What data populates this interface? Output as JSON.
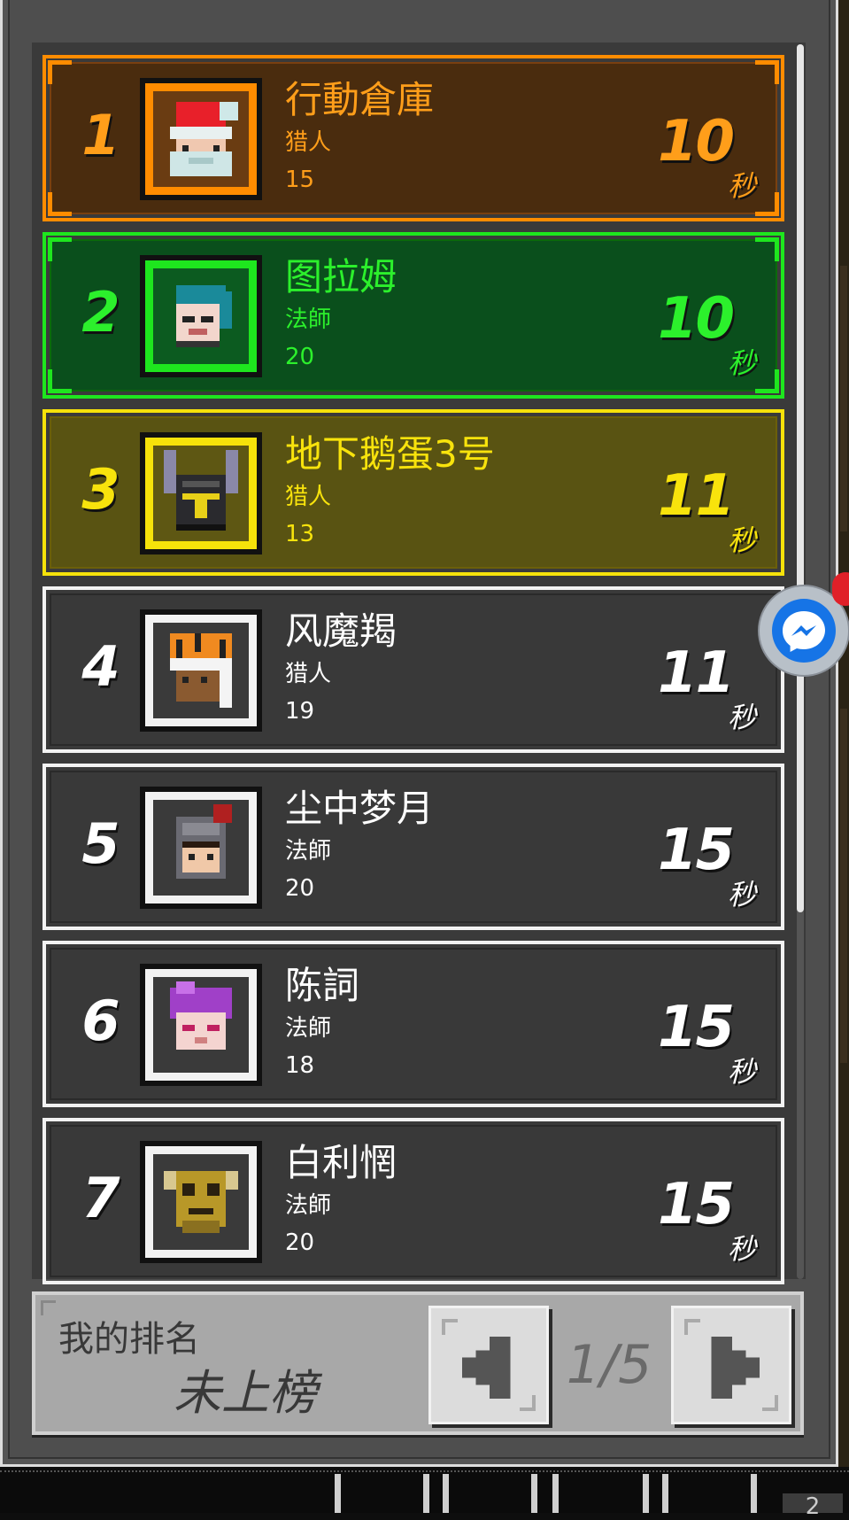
{
  "leaderboard": {
    "entries": [
      {
        "rank": "1",
        "name": "行動倉庫",
        "class": "猎人",
        "level": "15",
        "time": "10",
        "unit": "秒",
        "style": "gold",
        "avatar": "santa-hat-avatar-icon"
      },
      {
        "rank": "2",
        "name": "图拉姆",
        "class": "法師",
        "level": "20",
        "time": "10",
        "unit": "秒",
        "style": "green",
        "avatar": "teal-hair-avatar-icon"
      },
      {
        "rank": "3",
        "name": "地下鹅蛋3号",
        "class": "猎人",
        "level": "13",
        "time": "11",
        "unit": "秒",
        "style": "yellow",
        "avatar": "horned-helmet-avatar-icon"
      },
      {
        "rank": "4",
        "name": "风魔羯",
        "class": "猎人",
        "level": "19",
        "time": "11",
        "unit": "秒",
        "style": "white",
        "avatar": "tiger-hood-avatar-icon"
      },
      {
        "rank": "5",
        "name": "尘中梦月",
        "class": "法師",
        "level": "20",
        "time": "15",
        "unit": "秒",
        "style": "white",
        "avatar": "knight-helmet-avatar-icon"
      },
      {
        "rank": "6",
        "name": "陈詞",
        "class": "法師",
        "level": "18",
        "time": "15",
        "unit": "秒",
        "style": "white",
        "avatar": "purple-hair-avatar-icon"
      },
      {
        "rank": "7",
        "name": "白利惘",
        "class": "法師",
        "level": "20",
        "time": "15",
        "unit": "秒",
        "style": "white",
        "avatar": "golden-skull-avatar-icon"
      }
    ]
  },
  "footer": {
    "my_rank_label": "我的排名",
    "my_rank_value": "未上榜",
    "page_indicator": "1/5",
    "prev_icon": "left-arrow-icon",
    "next_icon": "right-arrow-icon"
  },
  "overlay": {
    "messenger_icon": "messenger-icon",
    "bottom_chip": "2"
  },
  "colors": {
    "gold": "#ff9e1a",
    "green": "#2cf02c",
    "yellow": "#f8e30c",
    "white": "#ffffff",
    "messenger": "#1674e6"
  }
}
